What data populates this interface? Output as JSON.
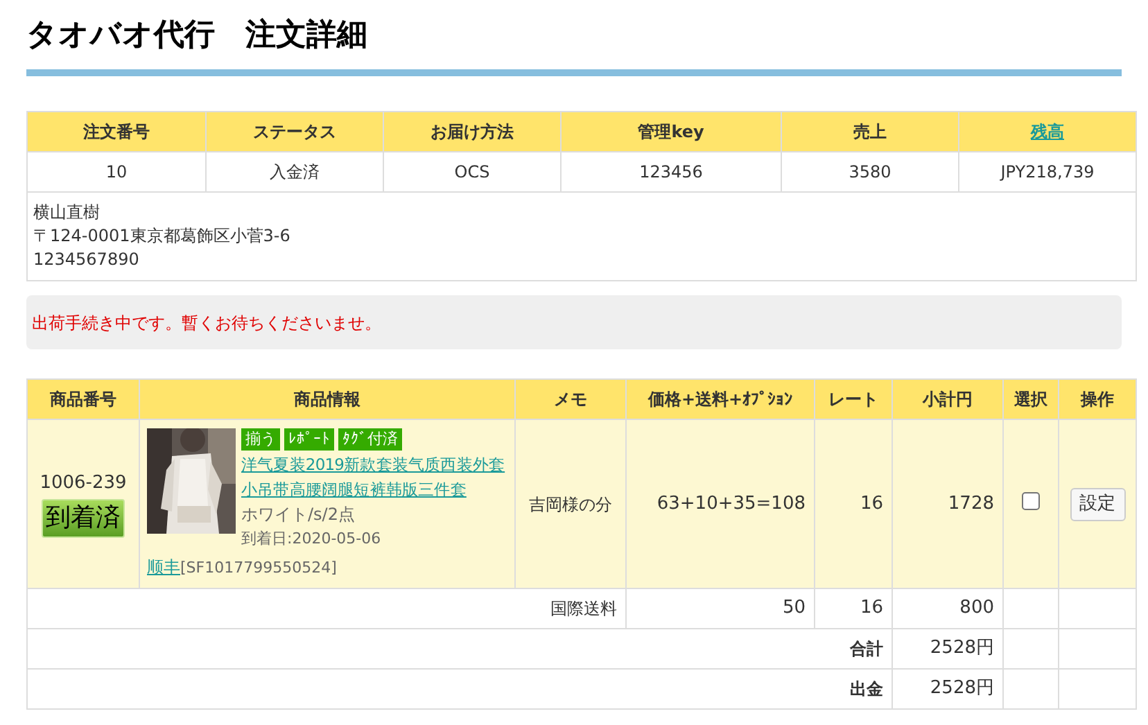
{
  "title": "タオバオ代行　注文詳細",
  "order": {
    "columns": [
      {
        "label": "注文番号",
        "link": false
      },
      {
        "label": "ステータス",
        "link": false
      },
      {
        "label": "お届け方法",
        "link": false
      },
      {
        "label": "管理key",
        "link": false
      },
      {
        "label": "売上",
        "link": false
      },
      {
        "label": "残高",
        "link": true
      }
    ],
    "values": [
      "10",
      "入金済",
      "OCS",
      "123456",
      "3580",
      "JPY218,739"
    ],
    "address": [
      "横山直樹",
      "〒124-0001東京都葛飾区小菅3-6",
      "1234567890"
    ]
  },
  "notice": "出荷手続き中です。暫くお待ちくださいませ。",
  "items": {
    "columns": [
      "商品番号",
      "商品情報",
      "メモ",
      "価格+送料+ｵﾌﾟｼｮﾝ",
      "レート",
      "小計円",
      "選択",
      "操作"
    ],
    "rows": [
      {
        "number": "1006-239",
        "status": "到着済",
        "tags": [
          "揃う",
          "ﾚﾎﾟｰﾄ",
          "ﾀｸﾞ付済"
        ],
        "name": "洋气夏装2019新款套装气质西装外套小吊带高腰阔腿短裤韩版三件套",
        "variant": "ホワイト/s/2点",
        "arrival": "到着日:2020-05-06",
        "carrier": "顺丰",
        "tracking": "[SF1017799550524]",
        "memo": "吉岡様の分",
        "price": "63+10+35=108",
        "rate": "16",
        "subtotal": "1728",
        "checked": false,
        "action": "設定"
      }
    ],
    "shipping": {
      "label": "国際送料",
      "price": "50",
      "rate": "16",
      "subtotal": "800"
    },
    "totals": [
      {
        "label": "合計",
        "value": "2528円"
      },
      {
        "label": "出金",
        "value": "2528円"
      }
    ]
  }
}
